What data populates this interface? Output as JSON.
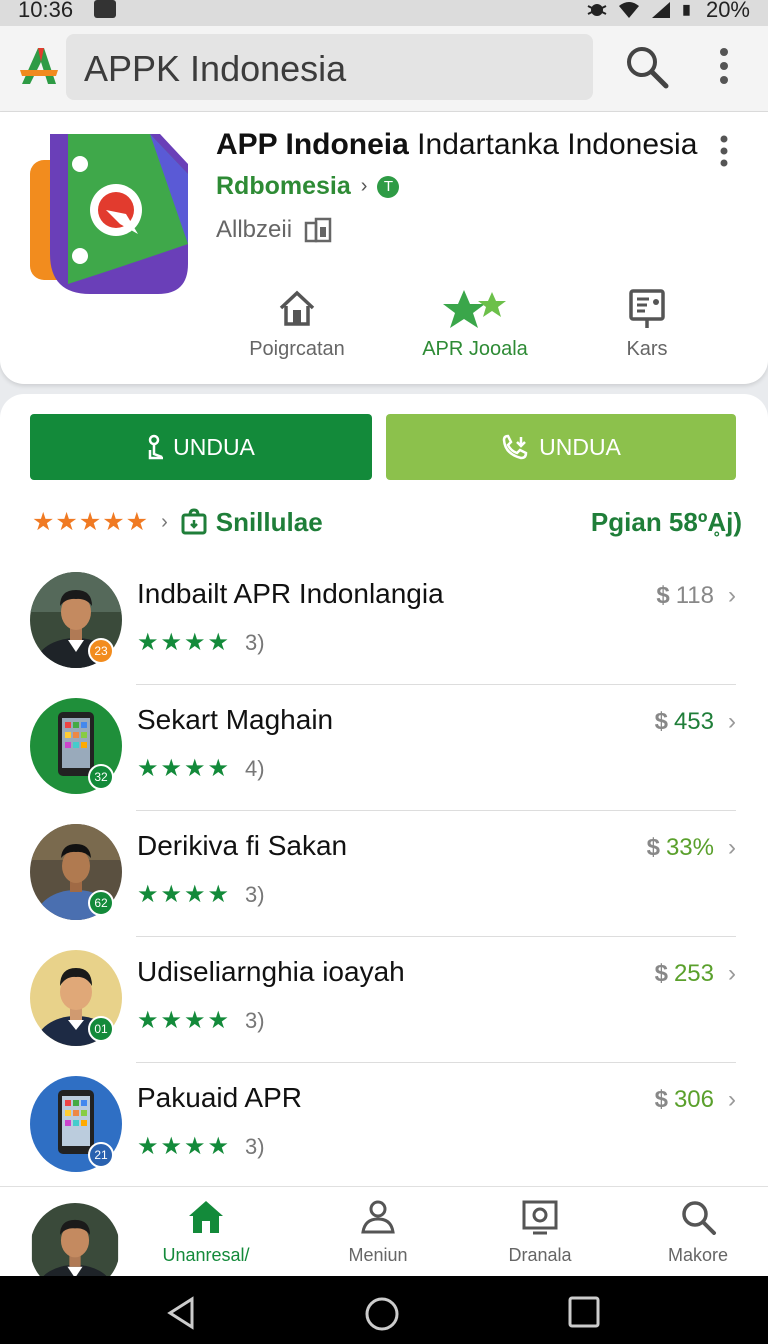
{
  "status": {
    "time": "10:36",
    "battery": "20%"
  },
  "search": {
    "query": "APPK Indonesia"
  },
  "app": {
    "title_bold": "APP Indoneia",
    "title_rest": "Indartanka Indonesia",
    "developer": "Rdbomesia",
    "developer_badge": "T",
    "age_rating": "Allbzeii",
    "stats": [
      {
        "label": "Poigrcatan",
        "icon": "home-outline-icon"
      },
      {
        "label": "APR Jooala",
        "icon": "stars-icon"
      },
      {
        "label": "Kars",
        "icon": "document-icon"
      }
    ]
  },
  "buttons": {
    "primary_label": "UNDUA",
    "secondary_label": "UNDUA"
  },
  "rating": {
    "stars": "★★★★★",
    "label": "Snillulae",
    "right_text": "Pgian 58ºḀj)"
  },
  "items": [
    {
      "name": "Indbailt APR Indonlangia",
      "stars": "★★★★",
      "count": "3)",
      "currency": "$",
      "price": "118",
      "badge": "23",
      "price_color": "#888888"
    },
    {
      "name": "Sekart Maghain",
      "stars": "★★★★",
      "count": "4)",
      "currency": "$",
      "price": "453",
      "badge": "32",
      "price_color": "#1f7e39"
    },
    {
      "name": "Derikiva fi Sakan",
      "stars": "★★★★",
      "count": "3)",
      "currency": "$",
      "price": "33%",
      "badge": "62",
      "price_color": "#5aa02c"
    },
    {
      "name": "Udiseliarnghia ioayah",
      "stars": "★★★★",
      "count": "3)",
      "currency": "$",
      "price": "253",
      "badge": "01",
      "price_color": "#5aa02c"
    },
    {
      "name": "Pakuaid APR",
      "stars": "★★★★",
      "count": "3)",
      "currency": "$",
      "price": "306",
      "badge": "21",
      "price_color": "#5aa02c"
    }
  ],
  "nav": [
    {
      "label": "Unanresal/",
      "icon": "home-icon"
    },
    {
      "label": "Meniun",
      "icon": "person-icon"
    },
    {
      "label": "Dranala",
      "icon": "media-icon"
    },
    {
      "label": "Makore",
      "icon": "search-icon"
    }
  ],
  "colors": {
    "primary": "#138a3a",
    "secondary": "#8cc14c",
    "star_orange": "#f07a23"
  }
}
